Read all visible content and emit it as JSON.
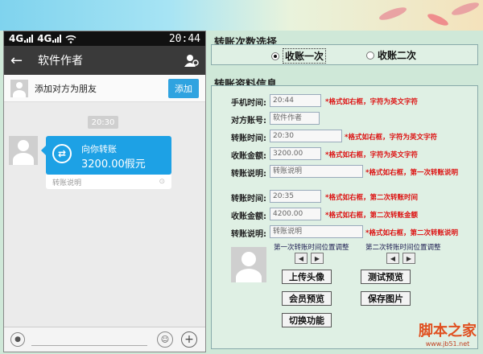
{
  "phone": {
    "status": {
      "net1": "4G",
      "net2": "4G",
      "time": "20:44"
    },
    "title": "软件作者",
    "add_friend_text": "添加对方为朋友",
    "add_button": "添加",
    "time_badge": "20:30",
    "bubble": {
      "title": "向你转账",
      "amount": "3200.00假元",
      "note": "转账说明"
    }
  },
  "count_section": {
    "title": "转账次数选择",
    "options": [
      {
        "label": "收账一次",
        "selected": true
      },
      {
        "label": "收账二次",
        "selected": false
      }
    ]
  },
  "info_section": {
    "title": "转账资料信息",
    "fields": [
      {
        "label": "手机时间:",
        "value": "20:44",
        "hint": "*格式如右框，字符为英文字符"
      },
      {
        "label": "对方账号:",
        "value": "软件作者",
        "hint": ""
      },
      {
        "label": "转账时间:",
        "value": "20:30",
        "hint": "*格式如右框，字符为英文字符"
      },
      {
        "label": "收账金额:",
        "value": "3200.00",
        "hint": "*格式如右框，字符为英文字符"
      },
      {
        "label": "转账说明:",
        "value": "转账说明",
        "hint": "*格式如右框，第一次转账说明"
      },
      {
        "label": "转账时间:",
        "value": "20:35",
        "hint": "*格式如右框，第二次转账时间"
      },
      {
        "label": "收账金额:",
        "value": "4200.00",
        "hint": "*格式如右框，第二次转账金额"
      },
      {
        "label": "转账说明:",
        "value": "转账说明",
        "hint": "*格式如右框，第二次转账说明"
      }
    ],
    "adjust1": "第一次转账时间位置调整",
    "adjust2": "第二次转账时间位置调整",
    "arrows": {
      "left": "◀",
      "right": "▶"
    },
    "buttons": {
      "upload": "上传头像",
      "test": "测试预览",
      "member": "会员预览",
      "save": "保存图片",
      "switch": "切换功能"
    }
  },
  "watermark": {
    "name": "脚本之家",
    "url": "www.jb51.net"
  },
  "icons": {
    "back": "back-arrow-icon",
    "user": "user-settings-icon",
    "mic": "mic-icon",
    "smile": "emoji-icon",
    "plus": "plus-icon"
  },
  "colors": {
    "accent": "#1da1e5",
    "hint": "#dd1111",
    "titlebar": "#3a3a3a"
  }
}
